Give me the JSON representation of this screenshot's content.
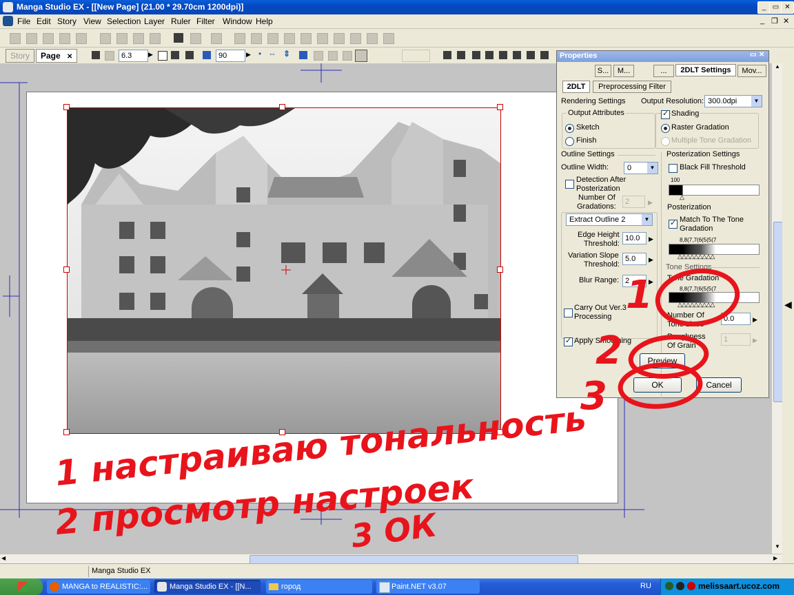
{
  "window": {
    "title": "Manga Studio EX - [[New Page] (21.00 * 29.70cm 1200dpi)]"
  },
  "menu": [
    "File",
    "Edit",
    "Story",
    "View",
    "Selection",
    "Layer",
    "Ruler",
    "Filter",
    "Window",
    "Help"
  ],
  "tabs": {
    "story": "Story",
    "page": "Page",
    "close": "✕"
  },
  "toolbar": {
    "zoom_value": "6.3",
    "angle_value": "90"
  },
  "properties": {
    "title": "Properties",
    "tabs": [
      "S...",
      "M...",
      "...",
      "2DLT Settings",
      "Mov..."
    ],
    "subtabs": [
      "2DLT",
      "Preprocessing Filter"
    ],
    "rendering_settings_label": "Rendering Settings",
    "output_resolution_label": "Output Resolution:",
    "output_resolution_value": "300.0dpi",
    "output_attributes_label": "Output Attributes",
    "sketch_label": "Sketch",
    "finish_label": "Finish",
    "shading_label": "Shading",
    "raster_gradation_label": "Raster Gradation",
    "multiple_tone_label": "Multiple Tone Gradation",
    "outline_settings_label": "Outline Settings",
    "outline_width_label": "Outline Width:",
    "outline_width_value": "0",
    "detection_label_1": "Detection After",
    "detection_label_2": "Posterization",
    "num_gradations_label_1": "Number Of",
    "num_gradations_label_2": "Gradations:",
    "num_gradations_value": "2",
    "extract_outline_value": "Extract Outline 2",
    "edge_height_label_1": "Edge Height",
    "edge_height_label_2": "Threshold:",
    "edge_height_value": "10.0",
    "variation_slope_label_1": "Variation Slope",
    "variation_slope_label_2": "Threshold:",
    "variation_slope_value": "5.0",
    "blur_range_label": "Blur Range:",
    "blur_range_value": "2",
    "carry_out_label_1": "Carry Out Ver.3",
    "carry_out_label_2": "Processing",
    "apply_smoothing_label": "Apply Smoothing",
    "posterization_settings_label": "Posterization Settings",
    "black_fill_label": "Black Fill Threshold",
    "black_fill_value": "100",
    "posterization_label": "Posterization",
    "match_tone_label_1": "Match To The Tone",
    "match_tone_label_2": "Gradation",
    "tone_values_1": "8,8(7,7(6(5(5(7",
    "tone_settings_label": "Tone Settings",
    "tone_gradation_label": "Tone Gradation",
    "tone_values_2": "8,8(7,7(6(5(5(7",
    "number_of_tone_lines_label_1": "Number Of",
    "number_of_tone_lines_label_2": "Tone Lines",
    "tone_lines_value": "0.0",
    "roughness_label_1": "Roughness",
    "roughness_label_2": "Of Grain",
    "roughness_value": "1",
    "preview_button": "Preview",
    "ok_button": "OK",
    "cancel_button": "Cancel"
  },
  "annotations": {
    "line1": "1 настраиваю тональность",
    "line2": "2 просмотр настроек",
    "line3": "3 ОК",
    "num1": "1",
    "num2": "2",
    "num3": "3"
  },
  "statusbar": {
    "app": "Manga Studio EX"
  },
  "taskbar": {
    "items": [
      "MANGA to REALISTIC:...",
      "Manga Studio EX - [[N...",
      "город",
      "Paint.NET v3.07"
    ],
    "lang": "RU",
    "watermark": "melissaart.ucoz.com"
  },
  "colors": {
    "annotation": "#e8141c",
    "selection": "#cc0000",
    "guides": "#2d2db4"
  }
}
